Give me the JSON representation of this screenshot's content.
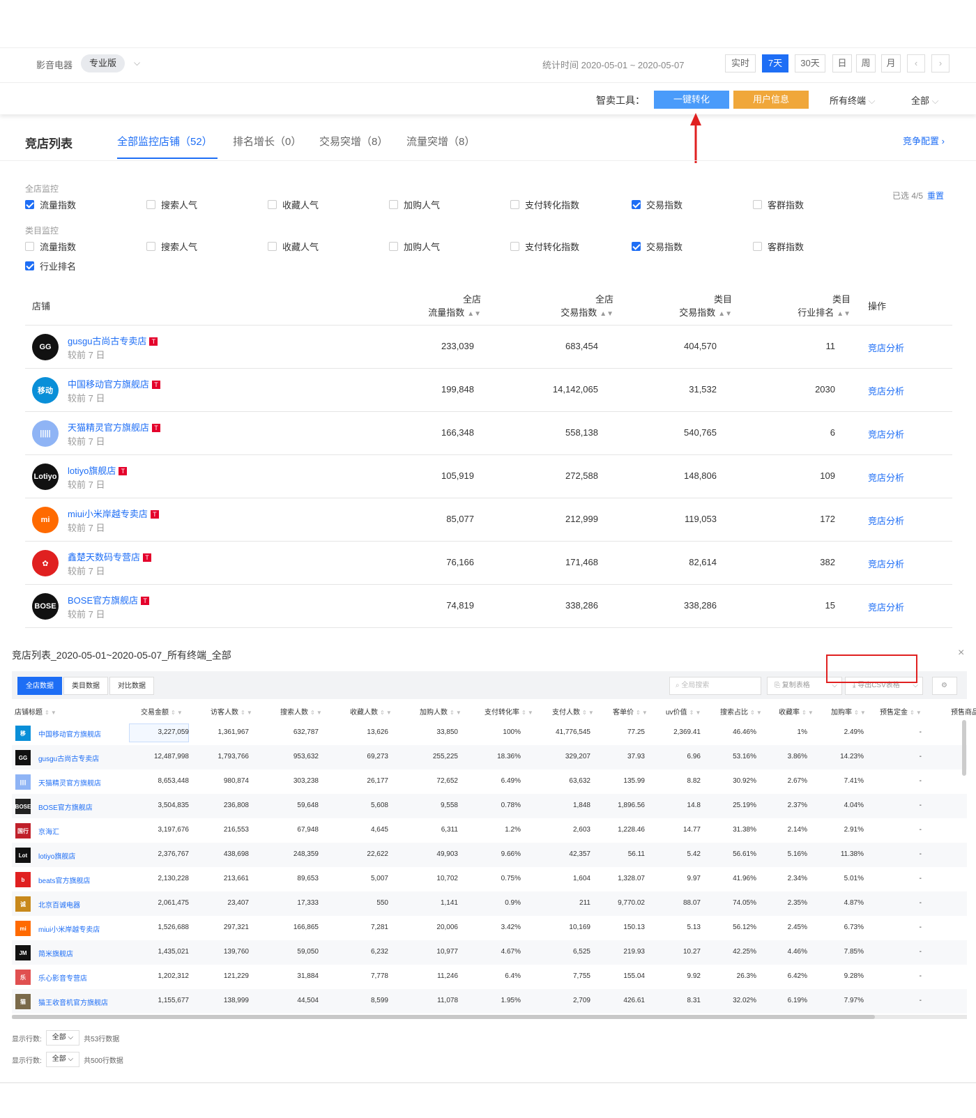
{
  "header": {
    "category": "影音电器",
    "edition": "专业版",
    "stat_time": "统计时间 2020-05-01 ~ 2020-05-07",
    "ranges": [
      "实时",
      "7天",
      "30天",
      "日",
      "周",
      "月"
    ],
    "active_range": "7天",
    "prev": "‹",
    "next": "›"
  },
  "toolbar": {
    "label": "智卖工具：",
    "convert_button": "一键转化",
    "user_button": "用户信息",
    "terminal": "所有终端",
    "scope": "全部"
  },
  "list": {
    "title": "竞店列表",
    "tabs": [
      "全部监控店铺（52）",
      "排名增长（0）",
      "交易突增（8）",
      "流量突增（8）"
    ],
    "config_link": "竞争配置 ›",
    "selected": "已选 4/5",
    "reset": "重置",
    "section_all": "全店监控",
    "section_cat": "类目监控",
    "all_checks": [
      {
        "label": "流量指数",
        "checked": true
      },
      {
        "label": "搜索人气",
        "checked": false
      },
      {
        "label": "收藏人气",
        "checked": false
      },
      {
        "label": "加购人气",
        "checked": false
      },
      {
        "label": "支付转化指数",
        "checked": false
      },
      {
        "label": "交易指数",
        "checked": true
      },
      {
        "label": "客群指数",
        "checked": false
      }
    ],
    "cat_checks": [
      {
        "label": "流量指数",
        "checked": false
      },
      {
        "label": "搜索人气",
        "checked": false
      },
      {
        "label": "收藏人气",
        "checked": false
      },
      {
        "label": "加购人气",
        "checked": false
      },
      {
        "label": "支付转化指数",
        "checked": false
      },
      {
        "label": "交易指数",
        "checked": true
      },
      {
        "label": "客群指数",
        "checked": false
      },
      {
        "label": "行业排名",
        "checked": true
      }
    ],
    "columns": {
      "shop": "店铺",
      "c1a": "全店",
      "c1b": "流量指数",
      "c2a": "全店",
      "c2b": "交易指数",
      "c3a": "类目",
      "c3b": "交易指数",
      "c4a": "类目",
      "c4b": "行业排名",
      "action": "操作"
    },
    "rows": [
      {
        "name": "gusgu古尚古专卖店",
        "sub": "较前 7 日",
        "flow": "233,039",
        "trade": "683,454",
        "cat_trade": "404,570",
        "rank": "11",
        "action": "竞店分析",
        "logo_text": "GG",
        "logo_color": "#111111"
      },
      {
        "name": "中国移动官方旗舰店",
        "sub": "较前 7 日",
        "flow": "199,848",
        "trade": "14,142,065",
        "cat_trade": "31,532",
        "rank": "2030",
        "action": "竞店分析",
        "logo_text": "移动",
        "logo_color": "#0a8fd8"
      },
      {
        "name": "天猫精灵官方旗舰店",
        "sub": "较前 7 日",
        "flow": "166,348",
        "trade": "558,138",
        "cat_trade": "540,765",
        "rank": "6",
        "action": "竞店分析",
        "logo_text": "|||||",
        "logo_color": "#8fb4f5"
      },
      {
        "name": "lotiyo旗舰店",
        "sub": "较前 7 日",
        "flow": "105,919",
        "trade": "272,588",
        "cat_trade": "148,806",
        "rank": "109",
        "action": "竞店分析",
        "logo_text": "Lotiyo",
        "logo_color": "#111111"
      },
      {
        "name": "miui小米岸越专卖店",
        "sub": "较前 7 日",
        "flow": "85,077",
        "trade": "212,999",
        "cat_trade": "119,053",
        "rank": "172",
        "action": "竞店分析",
        "logo_text": "mi",
        "logo_color": "#ff6a00"
      },
      {
        "name": "鑫楚天数码专营店",
        "sub": "较前 7 日",
        "flow": "76,166",
        "trade": "171,468",
        "cat_trade": "82,614",
        "rank": "382",
        "action": "竞店分析",
        "logo_text": "✿",
        "logo_color": "#e02020"
      },
      {
        "name": "BOSE官方旗舰店",
        "sub": "较前 7 日",
        "flow": "74,819",
        "trade": "338,286",
        "cat_trade": "338,286",
        "rank": "15",
        "action": "竞店分析",
        "logo_text": "BOSE",
        "logo_color": "#111111"
      }
    ]
  },
  "panel": {
    "title": "竞店列表_2020-05-01~2020-05-07_所有终端_全部",
    "close": "×",
    "tabs": [
      "全店数据",
      "类目数据",
      "对比数据"
    ],
    "search_placeholder": "全局搜索",
    "copy_button": "复制表格",
    "export_button": "导出CSV表格",
    "headers": [
      "店铺标题",
      "交易金额",
      "访客人数",
      "搜索人数",
      "收藏人数",
      "加购人数",
      "支付转化率",
      "支付人数",
      "客单价",
      "uv价值",
      "搜索占比",
      "收藏率",
      "加购率",
      "预售定金",
      "预售商品"
    ],
    "rows": [
      {
        "name": "中国移动官方旗舰店",
        "icon": "移",
        "icon_color": "#0a8fd8",
        "v": [
          "3,227,059",
          "1,361,967",
          "632,787",
          "13,626",
          "33,850",
          "100%",
          "41,776,545",
          "77.25",
          "2,369.41",
          "46.46%",
          "1%",
          "2.49%",
          "-"
        ]
      },
      {
        "name": "gusgu古尚古专卖店",
        "icon": "GG",
        "icon_color": "#111111",
        "v": [
          "12,487,998",
          "1,793,766",
          "953,632",
          "69,273",
          "255,225",
          "18.36%",
          "329,207",
          "37.93",
          "6.96",
          "53.16%",
          "3.86%",
          "14.23%",
          "-"
        ]
      },
      {
        "name": "天猫精灵官方旗舰店",
        "icon": "||||",
        "icon_color": "#8fb4f5",
        "v": [
          "8,653,448",
          "980,874",
          "303,238",
          "26,177",
          "72,652",
          "6.49%",
          "63,632",
          "135.99",
          "8.82",
          "30.92%",
          "2.67%",
          "7.41%",
          "-"
        ]
      },
      {
        "name": "BOSE官方旗舰店",
        "icon": "BOSE",
        "icon_color": "#222222",
        "v": [
          "3,504,835",
          "236,808",
          "59,648",
          "5,608",
          "9,558",
          "0.78%",
          "1,848",
          "1,896.56",
          "14.8",
          "25.19%",
          "2.37%",
          "4.04%",
          "-"
        ]
      },
      {
        "name": "京海汇",
        "icon": "国行",
        "icon_color": "#c0202a",
        "v": [
          "3,197,676",
          "216,553",
          "67,948",
          "4,645",
          "6,311",
          "1.2%",
          "2,603",
          "1,228.46",
          "14.77",
          "31.38%",
          "2.14%",
          "2.91%",
          "-"
        ]
      },
      {
        "name": "lotiyo旗舰店",
        "icon": "Lot",
        "icon_color": "#111111",
        "v": [
          "2,376,767",
          "438,698",
          "248,359",
          "22,622",
          "49,903",
          "9.66%",
          "42,357",
          "56.11",
          "5.42",
          "56.61%",
          "5.16%",
          "11.38%",
          "-"
        ]
      },
      {
        "name": "beats官方旗舰店",
        "icon": "b",
        "icon_color": "#e02020",
        "v": [
          "2,130,228",
          "213,661",
          "89,653",
          "5,007",
          "10,702",
          "0.75%",
          "1,604",
          "1,328.07",
          "9.97",
          "41.96%",
          "2.34%",
          "5.01%",
          "-"
        ]
      },
      {
        "name": "北京百诚电器",
        "icon": "诚",
        "icon_color": "#c8891c",
        "v": [
          "2,061,475",
          "23,407",
          "17,333",
          "550",
          "1,141",
          "0.9%",
          "211",
          "9,770.02",
          "88.07",
          "74.05%",
          "2.35%",
          "4.87%",
          "-"
        ]
      },
      {
        "name": "miui小米岸越专卖店",
        "icon": "mi",
        "icon_color": "#ff6a00",
        "v": [
          "1,526,688",
          "297,321",
          "166,865",
          "7,281",
          "20,006",
          "3.42%",
          "10,169",
          "150.13",
          "5.13",
          "56.12%",
          "2.45%",
          "6.73%",
          "-"
        ]
      },
      {
        "name": "简米旗舰店",
        "icon": "JM",
        "icon_color": "#111111",
        "v": [
          "1,435,021",
          "139,760",
          "59,050",
          "6,232",
          "10,977",
          "4.67%",
          "6,525",
          "219.93",
          "10.27",
          "42.25%",
          "4.46%",
          "7.85%",
          "-"
        ]
      },
      {
        "name": "乐心影音专营店",
        "icon": "乐",
        "icon_color": "#e05050",
        "v": [
          "1,202,312",
          "121,229",
          "31,884",
          "7,778",
          "11,246",
          "6.4%",
          "7,755",
          "155.04",
          "9.92",
          "26.3%",
          "6.42%",
          "9.28%",
          "-"
        ]
      },
      {
        "name": "猫王收音机官方旗舰店",
        "icon": "猫",
        "icon_color": "#7a6a4a",
        "v": [
          "1,155,677",
          "138,999",
          "44,504",
          "8,599",
          "11,078",
          "1.95%",
          "2,709",
          "426.61",
          "8.31",
          "32.02%",
          "6.19%",
          "7.97%",
          "-"
        ]
      }
    ],
    "footer1": {
      "label": "显示行数:",
      "value": "全部 ⌵",
      "count": "共53行数据"
    },
    "footer2": {
      "label": "显示行数:",
      "value": "全部 ⌵",
      "count": "共500行数据"
    }
  },
  "colors": {
    "accent": "#1e6ef5",
    "orange": "#f0a73a",
    "convert": "#4a9bfa",
    "tmall": "#e4002b",
    "highlight": "#e02020"
  }
}
